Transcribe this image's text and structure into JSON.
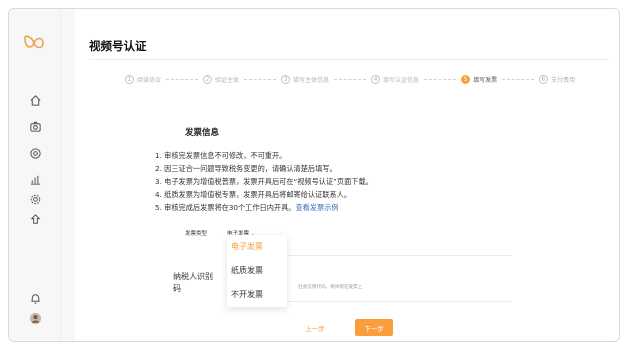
{
  "page": {
    "title": "视频号认证"
  },
  "steps": [
    {
      "num": "1",
      "label": "阅读协议",
      "active": false
    },
    {
      "num": "2",
      "label": "验证主体",
      "active": false
    },
    {
      "num": "3",
      "label": "填写主体信息",
      "active": false
    },
    {
      "num": "4",
      "label": "填写认证信息",
      "active": false
    },
    {
      "num": "5",
      "label": "填写发票",
      "active": true
    },
    {
      "num": "6",
      "label": "支付费用",
      "active": false
    }
  ],
  "invoice": {
    "section_title": "发票信息",
    "notes": [
      "1. 审核完发票信息不可修改，不可重开。",
      "2. 因三证合一问题导致税务变更的，请确认清楚后填写。",
      "3. 电子发票为增值税普票，发票开具后可在“视频号认证”页面下载。",
      "4. 纸质发票为增值税专票，发票开具后将邮寄给认证联系人。",
      "5. 审核完成后发票将在30个工作日内开具。"
    ],
    "example_link": "查看发票示例"
  },
  "form": {
    "invoice_type_label": "发票类型",
    "invoice_type_value": "电子发票",
    "dropdown_options": [
      "电子发票",
      "纸质发票",
      "不开发票"
    ],
    "selected_option": "电子发票",
    "tax_id_label": "纳税人识别码",
    "tax_id_hint": "社会信用代码，将体现在发票上"
  },
  "buttons": {
    "prev": "上一步",
    "next": "下一步"
  },
  "colors": {
    "accent": "#fa9d3b",
    "link": "#3e6ec0"
  },
  "sidebar": {
    "logo": "wechat-channels-logo",
    "icons": [
      "home-icon",
      "camera-icon",
      "target-icon",
      "chart-icon",
      "gear-icon",
      "puzzle-icon",
      "bell-icon",
      "avatar"
    ]
  }
}
